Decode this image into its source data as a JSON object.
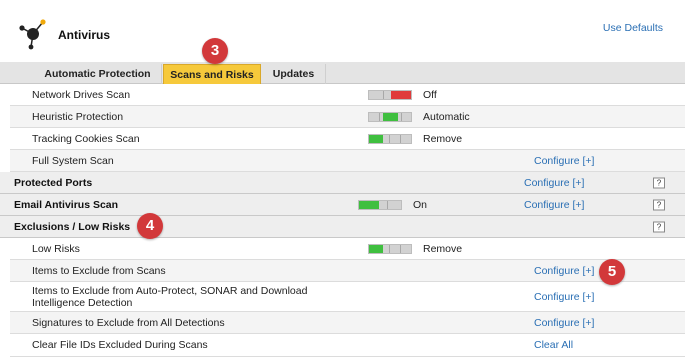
{
  "app": {
    "title": "Antivirus",
    "use_defaults": "Use Defaults"
  },
  "tabs": [
    {
      "label": "Automatic Protection"
    },
    {
      "label": "Scans and Risks"
    },
    {
      "label": "Updates"
    }
  ],
  "rows": {
    "network_drives": {
      "label": "Network Drives Scan",
      "state": "Off"
    },
    "heuristic": {
      "label": "Heuristic Protection",
      "state": "Automatic"
    },
    "tracking_cookies": {
      "label": "Tracking Cookies Scan",
      "state": "Remove"
    },
    "full_system": {
      "label": "Full System Scan",
      "action": "Configure [+]"
    },
    "protected_ports": {
      "label": "Protected Ports",
      "action": "Configure [+]",
      "help": "?"
    },
    "email_scan": {
      "label": "Email Antivirus Scan",
      "state": "On",
      "action": "Configure [+]",
      "help": "?"
    },
    "exclusions": {
      "label": "Exclusions / Low Risks",
      "help": "?"
    },
    "low_risks": {
      "label": "Low Risks",
      "state": "Remove"
    },
    "items_exclude": {
      "label": "Items to Exclude from Scans",
      "action": "Configure [+]"
    },
    "items_exclude_auto": {
      "label_line1": "Items to Exclude from Auto-Protect, SONAR and Download",
      "label_line2": "Intelligence Detection",
      "action": "Configure [+]"
    },
    "signatures": {
      "label": "Signatures to Exclude from All Detections",
      "action": "Configure [+]"
    },
    "clear_ids": {
      "label": "Clear File IDs Excluded During Scans",
      "action": "Clear All"
    }
  },
  "annotations": {
    "b3": "3",
    "b4": "4",
    "b5": "5"
  },
  "colors": {
    "accent_tab": "#f6c93b",
    "link": "#2a6fb4",
    "toggle_on": "#3fbf3f",
    "toggle_off": "#e03b3b",
    "badge": "#d2383a"
  },
  "toggle_positions": {
    "network_drives": "right-red",
    "heuristic": "middle-green",
    "tracking_cookies": "left-green",
    "email_scan": "left-green",
    "low_risks": "left-green"
  }
}
